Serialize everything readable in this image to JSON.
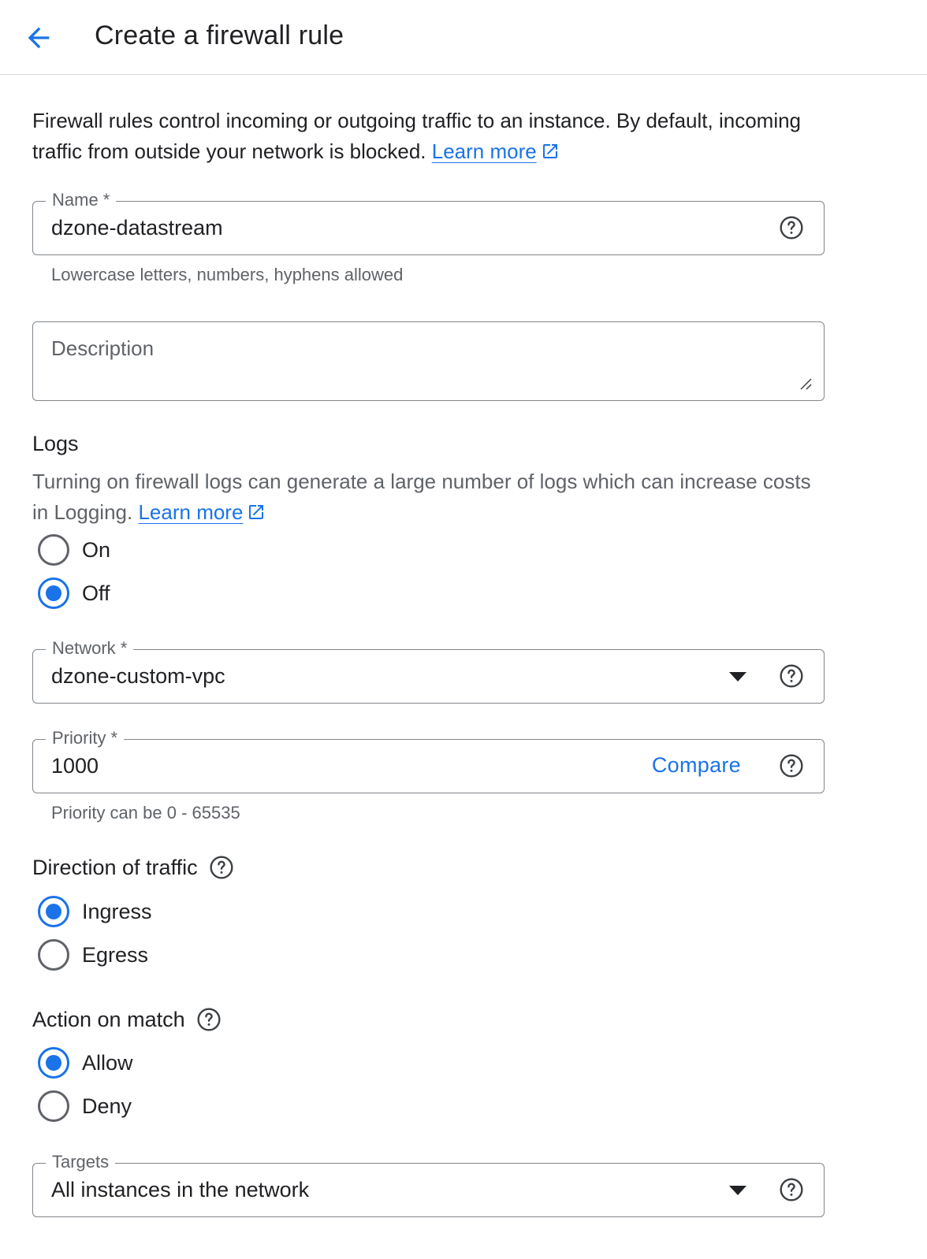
{
  "header": {
    "back_icon": "arrow-back-icon",
    "title": "Create a firewall rule"
  },
  "intro": {
    "text": "Firewall rules control incoming or outgoing traffic to an instance. By default, incoming traffic from outside your network is blocked.",
    "link": "Learn more"
  },
  "name_field": {
    "label": "Name *",
    "value": "dzone-datastream",
    "hint": "Lowercase letters, numbers, hyphens allowed"
  },
  "description_field": {
    "placeholder": "Description"
  },
  "logs": {
    "title": "Logs",
    "description": "Turning on firewall logs can generate a large number of logs which can increase costs in Logging.",
    "link": "Learn more",
    "options": [
      {
        "label": "On",
        "checked": false
      },
      {
        "label": "Off",
        "checked": true
      }
    ]
  },
  "network_field": {
    "label": "Network *",
    "value": "dzone-custom-vpc"
  },
  "priority_field": {
    "label": "Priority *",
    "value": "1000",
    "compare_label": "Compare",
    "hint": "Priority can be 0 - 65535"
  },
  "direction": {
    "title": "Direction of traffic",
    "options": [
      {
        "label": "Ingress",
        "checked": true
      },
      {
        "label": "Egress",
        "checked": false
      }
    ]
  },
  "action": {
    "title": "Action on match",
    "options": [
      {
        "label": "Allow",
        "checked": true
      },
      {
        "label": "Deny",
        "checked": false
      }
    ]
  },
  "targets_field": {
    "label": "Targets",
    "value": "All instances in the network"
  },
  "colors": {
    "accent": "#1a73e8",
    "text": "#202124",
    "secondary_text": "#5f6368",
    "border": "#80868b"
  }
}
